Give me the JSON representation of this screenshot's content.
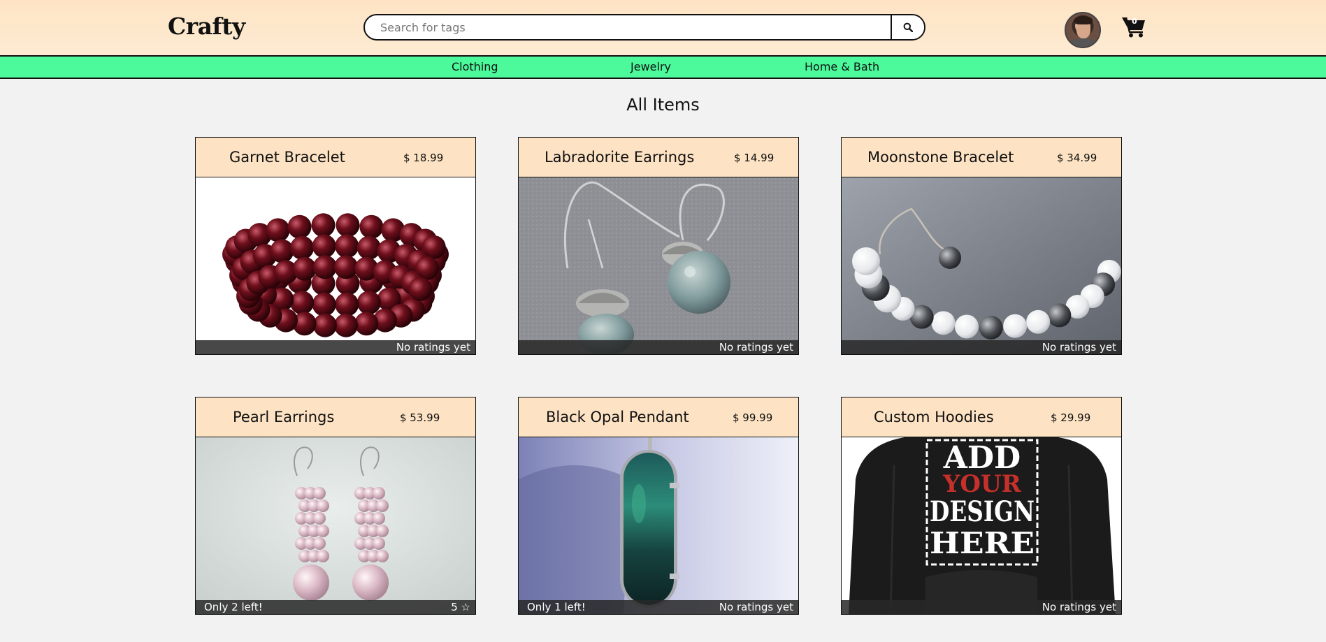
{
  "header": {
    "logo": "Crafty",
    "search_placeholder": "Search for tags",
    "cart_count": "0"
  },
  "nav": {
    "items": [
      "Clothing",
      "Jewelry",
      "Home & Bath"
    ]
  },
  "main": {
    "title": "All Items",
    "products": [
      {
        "name": "Garnet Bracelet",
        "price": "$ 18.99",
        "stock": "",
        "rating": "No ratings yet",
        "image_icon": "garnet-bracelet-image"
      },
      {
        "name": "Labradorite Earrings",
        "price": "$ 14.99",
        "stock": "",
        "rating": "No ratings yet",
        "image_icon": "labradorite-earrings-image"
      },
      {
        "name": "Moonstone Bracelet",
        "price": "$ 34.99",
        "stock": "",
        "rating": "No ratings yet",
        "image_icon": "moonstone-bracelet-image"
      },
      {
        "name": "Pearl Earrings",
        "price": "$ 53.99",
        "stock": "Only 2 left!",
        "rating": "5 ☆",
        "image_icon": "pearl-earrings-image"
      },
      {
        "name": "Black Opal Pendant",
        "price": "$ 99.99",
        "stock": "Only 1 left!",
        "rating": "No ratings yet",
        "image_icon": "black-opal-pendant-image"
      },
      {
        "name": "Custom Hoodies",
        "price": "$ 29.99",
        "stock": "",
        "rating": "No ratings yet",
        "image_icon": "custom-hoodie-image"
      }
    ],
    "hoodie_print": [
      "ADD",
      "YOUR",
      "DESIGN",
      "HERE"
    ]
  },
  "colors": {
    "header_bg": "#fee4c4",
    "nav_bg": "#4cf99b",
    "card_head_bg": "#fde3c4",
    "page_bg": "#f2f2f2"
  }
}
